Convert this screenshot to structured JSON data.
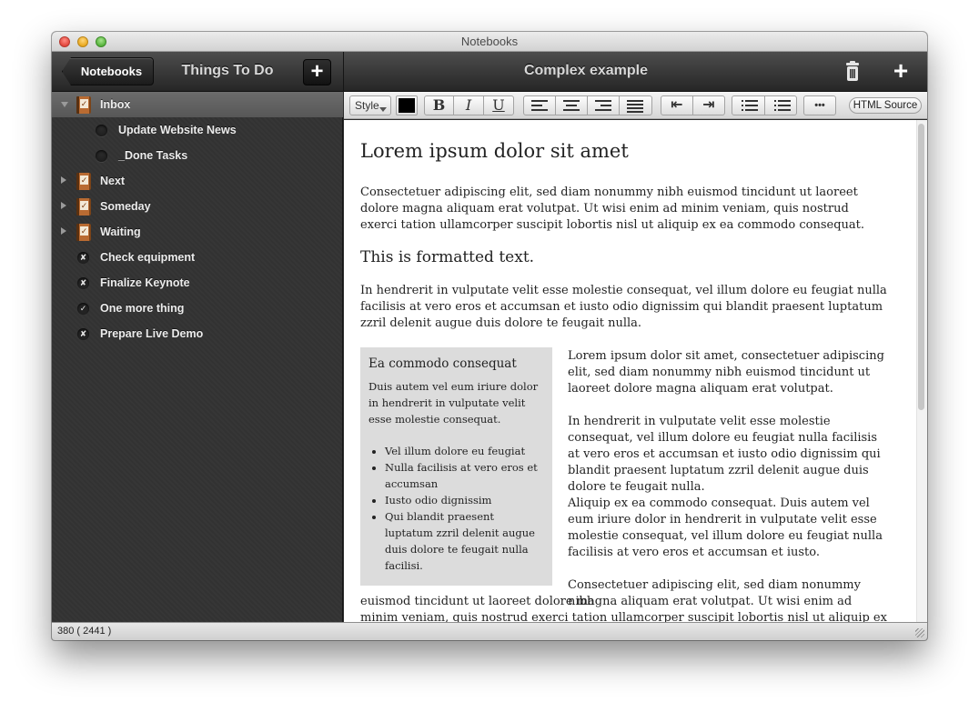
{
  "window": {
    "title": "Notebooks"
  },
  "topbar": {
    "back_label": "Notebooks",
    "list_title": "Things To Do",
    "add_list_label": "+",
    "note_title": "Complex example",
    "add_note_label": "+"
  },
  "sidebar": {
    "items": [
      {
        "label": "Inbox",
        "kind": "notebook",
        "expanded": true,
        "selected": true
      },
      {
        "label": "Update Website News",
        "kind": "task"
      },
      {
        "label": "_Done Tasks",
        "kind": "task"
      },
      {
        "label": "Next",
        "kind": "notebook",
        "expanded": false
      },
      {
        "label": "Someday",
        "kind": "notebook",
        "expanded": false
      },
      {
        "label": "Waiting",
        "kind": "notebook",
        "expanded": false
      },
      {
        "label": "Check equipment",
        "kind": "done",
        "mark": "✘"
      },
      {
        "label": "Finalize Keynote",
        "kind": "done",
        "mark": "✘"
      },
      {
        "label": "One more thing",
        "kind": "done",
        "mark": "✓"
      },
      {
        "label": "Prepare Live Demo",
        "kind": "done",
        "mark": "✘"
      }
    ]
  },
  "toolbar": {
    "style_label": "Style",
    "color": "#000000",
    "bold_label": "B",
    "italic_label": "I",
    "underline_label": "U",
    "more_label": "•••",
    "html_source_label": "HTML Source"
  },
  "doc": {
    "heading": "Lorem ipsum dolor sit amet",
    "para1": "Consectetuer adipiscing elit, sed diam nonummy nibh euismod tincidunt ut laoreet dolore magna aliquam erat volutpat. Ut wisi enim ad minim veniam, quis nostrud exerci tation ullamcorper suscipit lobortis nisl ut aliquip ex ea commodo consequat.",
    "subheading": "This is formatted text.",
    "para2": "In hendrerit in vulputate velit esse molestie consequat, vel illum dolore eu feugiat nulla facilisis at vero eros et accumsan et iusto odio dignissim qui blandit praesent luptatum zzril delenit augue duis dolore te feugait nulla.",
    "box": {
      "title": "Ea commodo consequat",
      "text": "Duis autem vel eum iriure dolor in hendrerit in vulputate velit esse molestie consequat.",
      "bullets": [
        "Vel illum dolore eu feugiat",
        "Nulla facilisis at vero eros et accumsan",
        "Iusto odio dignissim",
        "Qui blandit praesent luptatum zzril delenit augue duis dolore te feugait nulla facilisi."
      ]
    },
    "right1": "Lorem ipsum dolor sit amet, consectetuer adipiscing elit, sed diam nonummy nibh euismod tincidunt ut laoreet dolore magna aliquam erat volutpat.",
    "right2": "In hendrerit in vulputate velit esse molestie consequat, vel illum dolore eu feugiat nulla facilisis at vero eros et accumsan et iusto odio dignissim qui blandit praesent luptatum zzril delenit augue duis dolore te feugait nulla.",
    "right3": "Aliquip ex ea commodo consequat. Duis autem vel eum iriure dolor in hendrerit in vulputate velit esse molestie consequat, vel illum dolore eu feugiat nulla facilisis at vero eros et accumsan et iusto.",
    "right4": "Consectetuer adipiscing elit, sed diam nonummy nibh",
    "para_bottom": "euismod tincidunt ut laoreet dolore magna aliquam erat volutpat. Ut wisi enim ad minim veniam, quis nostrud exerci tation ullamcorper suscipit lobortis nisl ut aliquip ex ea"
  },
  "status": {
    "text": "380 ( 2441 )"
  }
}
